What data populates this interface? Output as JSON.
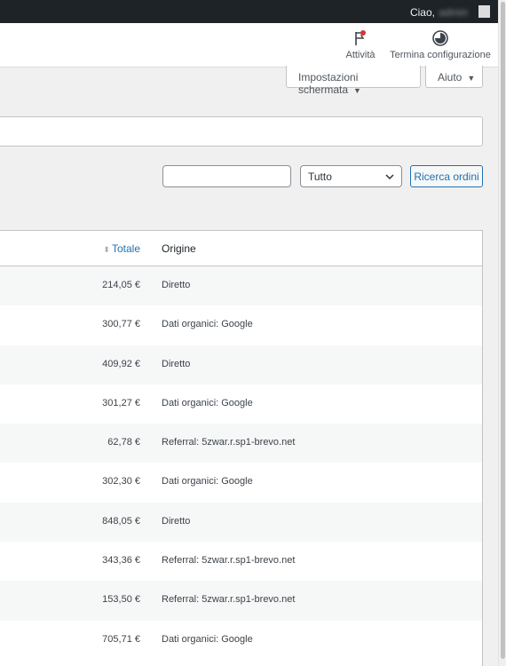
{
  "admin_bar": {
    "greeting": "Ciao,",
    "username": "admin"
  },
  "header": {
    "activity_label": "Attività",
    "finish_setup_label": "Termina configurazione"
  },
  "screen_meta": {
    "screen_options_label": "Impostazioni schermata",
    "help_label": "Aiuto"
  },
  "search": {
    "input_value": "",
    "status_selected": "Tutto",
    "button_label": "Ricerca ordini"
  },
  "table": {
    "columns": {
      "total": "Totale",
      "origin": "Origine"
    },
    "rows": [
      {
        "total": "214,05 €",
        "origin": "Diretto"
      },
      {
        "total": "300,77 €",
        "origin": "Dati organici: Google"
      },
      {
        "total": "409,92 €",
        "origin": "Diretto"
      },
      {
        "total": "301,27 €",
        "origin": "Dati organici: Google"
      },
      {
        "total": "62,78 €",
        "origin": "Referral: 5zwar.r.sp1-brevo.net"
      },
      {
        "total": "302,30 €",
        "origin": "Dati organici: Google"
      },
      {
        "total": "848,05 €",
        "origin": "Diretto"
      },
      {
        "total": "343,36 €",
        "origin": "Referral: 5zwar.r.sp1-brevo.net"
      },
      {
        "total": "153,50 €",
        "origin": "Referral: 5zwar.r.sp1-brevo.net"
      },
      {
        "total": "705,71 €",
        "origin": "Dati organici: Google"
      }
    ]
  },
  "icons": {
    "activity": "flag-icon",
    "finish_setup": "progress-circle-icon",
    "sort": "sort-icon"
  },
  "colors": {
    "admin_bar": "#1d2327",
    "link": "#2271b1",
    "notification_dot": "#d63638"
  }
}
